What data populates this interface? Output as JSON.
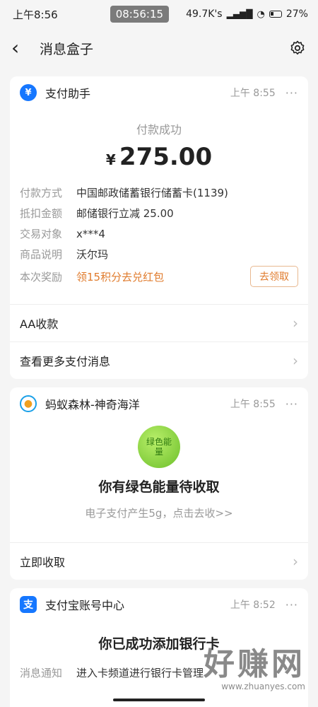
{
  "status_bar": {
    "time": "上午8:56",
    "clock_badge": "08:56:15",
    "net_speed": "49.7K's",
    "battery": "27%"
  },
  "nav": {
    "title": "消息盒子"
  },
  "card_pay": {
    "name": "支付助手",
    "time": "上午 8:55",
    "status": "付款成功",
    "currency": "¥",
    "amount": "275.00",
    "details": [
      {
        "k": "付款方式",
        "v": "中国邮政储蓄银行储蓄卡(1139)"
      },
      {
        "k": "抵扣金额",
        "v": "邮储银行立减 25.00"
      },
      {
        "k": "交易对象",
        "v": "x***4"
      },
      {
        "k": "商品说明",
        "v": "沃尔玛"
      }
    ],
    "reward_label": "本次奖励",
    "reward_text": "领15积分去兑红包",
    "reward_button": "去领取",
    "link1": "AA收款",
    "link2": "查看更多支付消息"
  },
  "card_forest": {
    "name": "蚂蚁森林-神奇海洋",
    "time": "上午 8:55",
    "badge_text": "绿色能量",
    "headline": "你有绿色能量待收取",
    "sub": "电子支付产生5g，点击去收>>",
    "link": "立即收取"
  },
  "card_account": {
    "name": "支付宝账号中心",
    "time": "上午 8:52",
    "headline": "你已成功添加银行卡",
    "k": "消息通知",
    "v": "进入卡频道进行银行卡管理"
  },
  "watermark": {
    "text": "好赚网",
    "url": "www.zhuanyes.com"
  },
  "colors": {
    "accent_orange": "#e07b2c",
    "alipay_blue": "#1677ff",
    "green": "#7cc43a"
  }
}
